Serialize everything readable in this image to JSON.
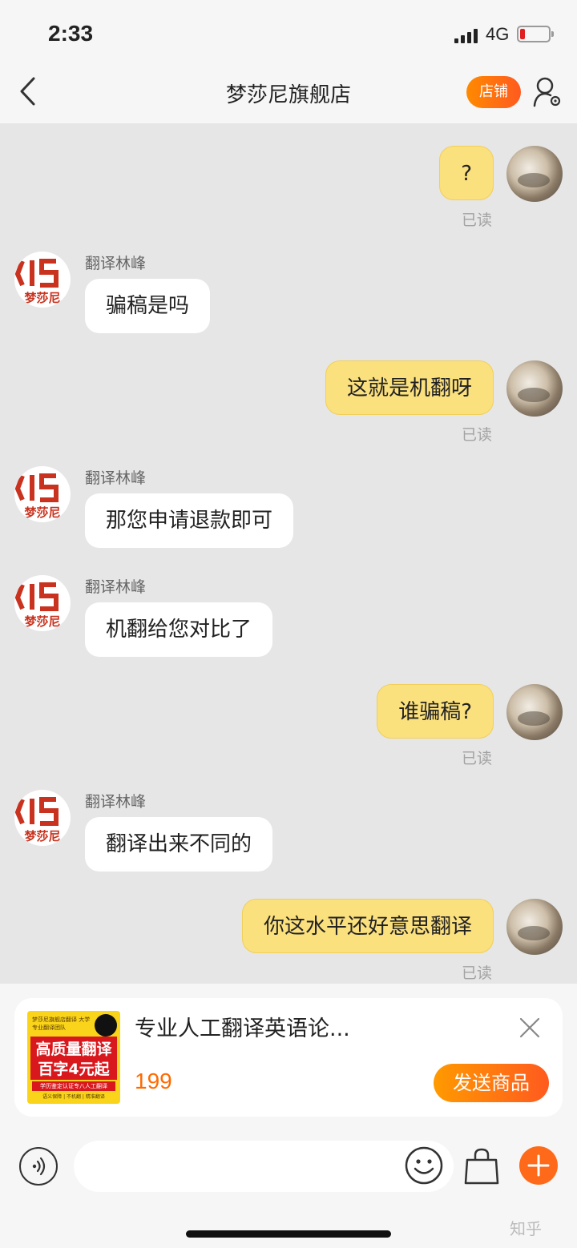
{
  "status_bar": {
    "time": "2:33",
    "network": "4G"
  },
  "header": {
    "title": "梦莎尼旗舰店",
    "shop_button": "店铺"
  },
  "messages": [
    {
      "from": "self",
      "text": "?",
      "read": "已读"
    },
    {
      "from": "shop",
      "sender": "翻译林峰",
      "text": "骗稿是吗",
      "logo": "梦莎尼"
    },
    {
      "from": "self",
      "text": "这就是机翻呀",
      "read": "已读"
    },
    {
      "from": "shop",
      "sender": "翻译林峰",
      "text": "那您申请退款即可",
      "logo": "梦莎尼"
    },
    {
      "from": "shop",
      "sender": "翻译林峰",
      "text": "机翻给您对比了",
      "logo": "梦莎尼"
    },
    {
      "from": "self",
      "text": "谁骗稿?",
      "read": "已读"
    },
    {
      "from": "shop",
      "sender": "翻译林峰",
      "text": "翻译出来不同的",
      "logo": "梦莎尼"
    },
    {
      "from": "self",
      "text": "你这水平还好意思翻译",
      "read": "已读"
    }
  ],
  "product_card": {
    "title": "专业人工翻译英语论...",
    "price": "199",
    "send_button": "发送商品",
    "thumb_line1": "高质量翻译",
    "thumb_line2": "百字4元起",
    "thumb_top": "梦莎尼旗舰店翻译 大学专业翻译团队",
    "thumb_bottom": "学历鉴定认证专八人工翻译",
    "thumb_footer": "语义保障 | 不机翻 | 精准翻译"
  },
  "watermark": "知乎"
}
